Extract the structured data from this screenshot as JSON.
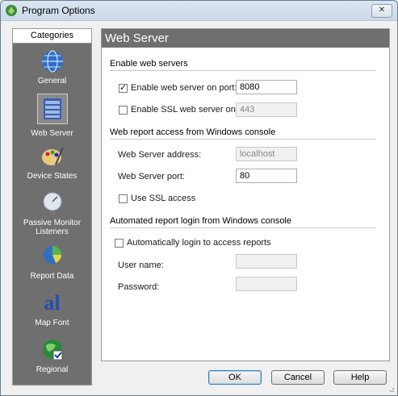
{
  "window": {
    "title": "Program Options",
    "close_glyph": "✕"
  },
  "sidebar": {
    "header": "Categories",
    "items": [
      {
        "label": "General",
        "icon": "globe-icon"
      },
      {
        "label": "Web Server",
        "icon": "server-icon",
        "selected": true
      },
      {
        "label": "Device States",
        "icon": "palette-icon"
      },
      {
        "label": "Passive Monitor Listeners",
        "icon": "satellite-dish-icon"
      },
      {
        "label": "Report Data",
        "icon": "pie-chart-icon"
      },
      {
        "label": "Map Font",
        "icon": "font-icon",
        "glyph": "al"
      },
      {
        "label": "Regional",
        "icon": "regional-globe-icon"
      }
    ]
  },
  "panel": {
    "title": "Web Server",
    "sections": {
      "enable": {
        "label": "Enable web servers",
        "web_server": {
          "label": "Enable web server on port:",
          "checked": true,
          "value": "8080"
        },
        "ssl_server": {
          "label": "Enable SSL web server on port:",
          "checked": false,
          "value": "443"
        }
      },
      "access": {
        "label": "Web report access from Windows console",
        "address": {
          "label": "Web Server address:",
          "value": "localhost"
        },
        "port": {
          "label": "Web Server port:",
          "value": "80"
        },
        "use_ssl": {
          "label": "Use SSL access",
          "checked": false
        }
      },
      "login": {
        "label": "Automated report login from Windows console",
        "auto_login": {
          "label": "Automatically login to access reports",
          "checked": false
        },
        "username": {
          "label": "User name:",
          "value": ""
        },
        "password": {
          "label": "Password:",
          "value": ""
        }
      }
    }
  },
  "buttons": {
    "ok": "OK",
    "cancel": "Cancel",
    "help": "Help"
  },
  "colors": {
    "sidebar_bg": "#6f6f6f",
    "header_bg": "#6f6f6f",
    "default_button_border": "#3c7fb1"
  }
}
